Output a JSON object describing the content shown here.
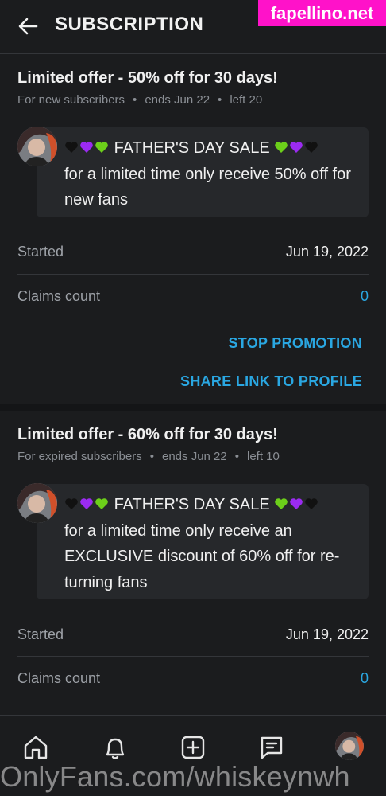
{
  "header": {
    "title": "SUBSCRIPTION"
  },
  "watermark_top": "fapellino.net",
  "watermark_bottom": "OnlyFans.com/whiskeynwh",
  "offers": [
    {
      "title": "Limited offer - 50% off for 30 days!",
      "audience": "For new subscribers",
      "ends": "ends Jun 22",
      "left": "left 20",
      "message_title": "FATHER'S DAY SALE",
      "message_body": "for a limited time only receive 50% off for new fans",
      "started_label": "Started",
      "started_value": "Jun 19, 2022",
      "claims_label": "Claims count",
      "claims_value": "0",
      "stop_label": "STOP PROMOTION",
      "share_label": "SHARE LINK TO PROFILE"
    },
    {
      "title": "Limited offer - 60% off for 30 days!",
      "audience": "For expired subscribers",
      "ends": "ends Jun 22",
      "left": "left 10",
      "message_title": "FATHER'S DAY SALE",
      "message_body_1": "for a limited time only receive an",
      "message_body_2": "EXCLUSIVE discount of 60% off for re-",
      "message_body_3": "turning fans",
      "started_label": "Started",
      "started_value": "Jun 19, 2022",
      "claims_label": "Claims count",
      "claims_value": "0"
    }
  ],
  "nav": {
    "items": [
      "home-icon",
      "bell-icon",
      "plus-square-icon",
      "message-icon",
      "profile-avatar"
    ]
  },
  "colors": {
    "background": "#1b1c1e",
    "accent": "#2aa7e2",
    "watermark": "#ff12c9",
    "heart_black": "#111111",
    "heart_purple": "#9b2bf0",
    "heart_green": "#6ccf1a"
  }
}
